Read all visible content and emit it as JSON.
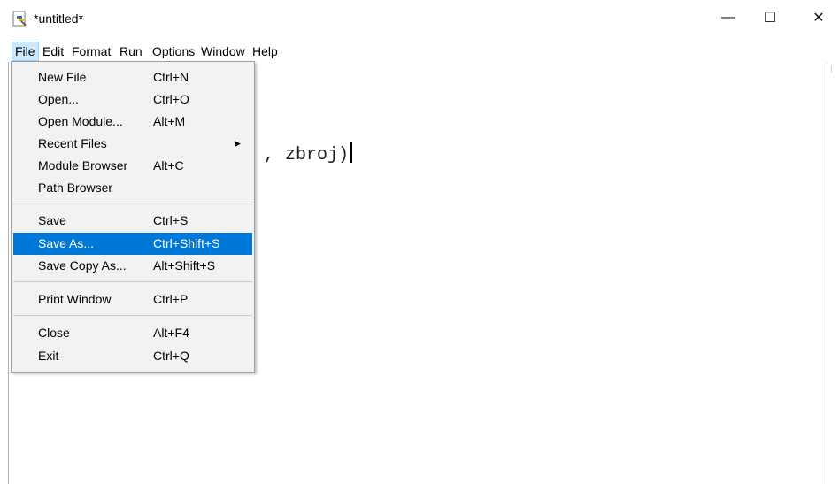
{
  "window": {
    "title": "*untitled*",
    "controls": {
      "minimize": "—",
      "maximize": "☐",
      "close": "✕"
    }
  },
  "menubar": {
    "items": [
      {
        "label": "File",
        "active": true
      },
      {
        "label": "Edit"
      },
      {
        "label": "Format"
      },
      {
        "label": "Run"
      },
      {
        "label": "Options"
      },
      {
        "label": "Window"
      },
      {
        "label": "Help"
      }
    ]
  },
  "editor": {
    "code": ", zbroj)"
  },
  "file_menu": {
    "items": [
      {
        "label": "New File",
        "shortcut": "Ctrl+N"
      },
      {
        "label": "Open...",
        "shortcut": "Ctrl+O"
      },
      {
        "label": "Open Module...",
        "shortcut": "Alt+M"
      },
      {
        "label": "Recent Files",
        "shortcut": "",
        "submenu_arrow": "▶"
      },
      {
        "label": "Module Browser",
        "shortcut": "Alt+C"
      },
      {
        "label": "Path Browser",
        "shortcut": ""
      },
      {
        "label": "Save",
        "shortcut": "Ctrl+S"
      },
      {
        "label": "Save As...",
        "shortcut": "Ctrl+Shift+S",
        "highlighted": true
      },
      {
        "label": "Save Copy As...",
        "shortcut": "Alt+Shift+S"
      },
      {
        "label": "Print Window",
        "shortcut": "Ctrl+P"
      },
      {
        "label": "Close",
        "shortcut": "Alt+F4"
      },
      {
        "label": "Exit",
        "shortcut": "Ctrl+Q"
      }
    ]
  },
  "colors": {
    "highlight": "#0078d7",
    "menu_background": "#f2f2f2",
    "active_menu": "#cce8ff"
  }
}
